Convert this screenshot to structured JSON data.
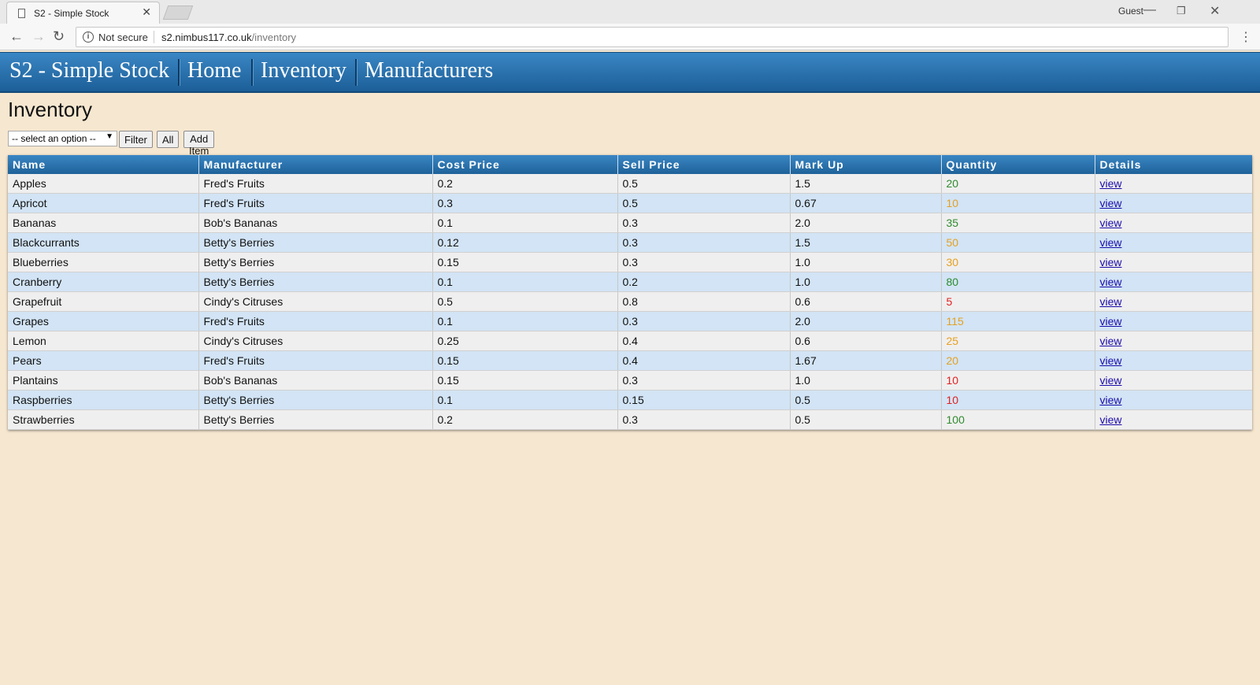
{
  "browser": {
    "tab_title": "S2 - Simple Stock",
    "tab_close": "✕",
    "profile": "Guest",
    "security_label": "Not secure",
    "url_host": "s2.nimbus117.co.uk",
    "url_path": "/inventory"
  },
  "app": {
    "brand": "S2 - Simple Stock",
    "nav": [
      "Home",
      "Inventory",
      "Manufacturers"
    ]
  },
  "page": {
    "title": "Inventory",
    "filter_select": "-- select an option --",
    "filter_button": "Filter",
    "all_button": "All",
    "add_button": "Add Item"
  },
  "table": {
    "headers": [
      "Name",
      "Manufacturer",
      "Cost Price",
      "Sell Price",
      "Mark Up",
      "Quantity",
      "Details"
    ],
    "rows": [
      {
        "name": "Apples",
        "manufacturer": "Fred's Fruits",
        "cost": "0.2",
        "sell": "0.5",
        "markup": "1.5",
        "quantity": "20",
        "qty_color": "#2e8b2e",
        "details": "view"
      },
      {
        "name": "Apricot",
        "manufacturer": "Fred's Fruits",
        "cost": "0.3",
        "sell": "0.5",
        "markup": "0.67",
        "quantity": "10",
        "qty_color": "#e6a020",
        "details": "view"
      },
      {
        "name": "Bananas",
        "manufacturer": "Bob's Bananas",
        "cost": "0.1",
        "sell": "0.3",
        "markup": "2.0",
        "quantity": "35",
        "qty_color": "#2e8b2e",
        "details": "view"
      },
      {
        "name": "Blackcurrants",
        "manufacturer": "Betty's Berries",
        "cost": "0.12",
        "sell": "0.3",
        "markup": "1.5",
        "quantity": "50",
        "qty_color": "#e6a020",
        "details": "view"
      },
      {
        "name": "Blueberries",
        "manufacturer": "Betty's Berries",
        "cost": "0.15",
        "sell": "0.3",
        "markup": "1.0",
        "quantity": "30",
        "qty_color": "#e6a020",
        "details": "view"
      },
      {
        "name": "Cranberry",
        "manufacturer": "Betty's Berries",
        "cost": "0.1",
        "sell": "0.2",
        "markup": "1.0",
        "quantity": "80",
        "qty_color": "#2e8b2e",
        "details": "view"
      },
      {
        "name": "Grapefruit",
        "manufacturer": "Cindy's Citruses",
        "cost": "0.5",
        "sell": "0.8",
        "markup": "0.6",
        "quantity": "5",
        "qty_color": "#e02020",
        "details": "view"
      },
      {
        "name": "Grapes",
        "manufacturer": "Fred's Fruits",
        "cost": "0.1",
        "sell": "0.3",
        "markup": "2.0",
        "quantity": "115",
        "qty_color": "#e6a020",
        "details": "view"
      },
      {
        "name": "Lemon",
        "manufacturer": "Cindy's Citruses",
        "cost": "0.25",
        "sell": "0.4",
        "markup": "0.6",
        "quantity": "25",
        "qty_color": "#e6a020",
        "details": "view"
      },
      {
        "name": "Pears",
        "manufacturer": "Fred's Fruits",
        "cost": "0.15",
        "sell": "0.4",
        "markup": "1.67",
        "quantity": "20",
        "qty_color": "#e6a020",
        "details": "view"
      },
      {
        "name": "Plantains",
        "manufacturer": "Bob's Bananas",
        "cost": "0.15",
        "sell": "0.3",
        "markup": "1.0",
        "quantity": "10",
        "qty_color": "#e02020",
        "details": "view"
      },
      {
        "name": "Raspberries",
        "manufacturer": "Betty's Berries",
        "cost": "0.1",
        "sell": "0.15",
        "markup": "0.5",
        "quantity": "10",
        "qty_color": "#e02020",
        "details": "view"
      },
      {
        "name": "Strawberries",
        "manufacturer": "Betty's Berries",
        "cost": "0.2",
        "sell": "0.3",
        "markup": "0.5",
        "quantity": "100",
        "qty_color": "#2e8b2e",
        "details": "view"
      }
    ]
  }
}
